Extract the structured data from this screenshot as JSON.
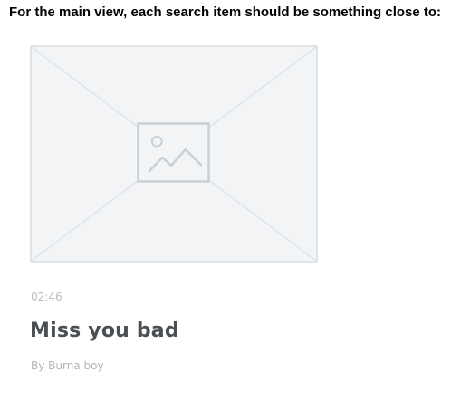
{
  "instruction": "For the main view, each search item should be something close to:",
  "search_item": {
    "thumbnail_icon": "image-placeholder-icon",
    "duration": "02:46",
    "title": "Miss you bad",
    "artist": "By Burna boy"
  },
  "colors": {
    "placeholder_bg": "#f2f4f6",
    "placeholder_lines": "#dfe4e8",
    "icon_stroke": "#c7d0d6",
    "title_text": "#4a4f55",
    "muted_text": "#b9bec3"
  }
}
